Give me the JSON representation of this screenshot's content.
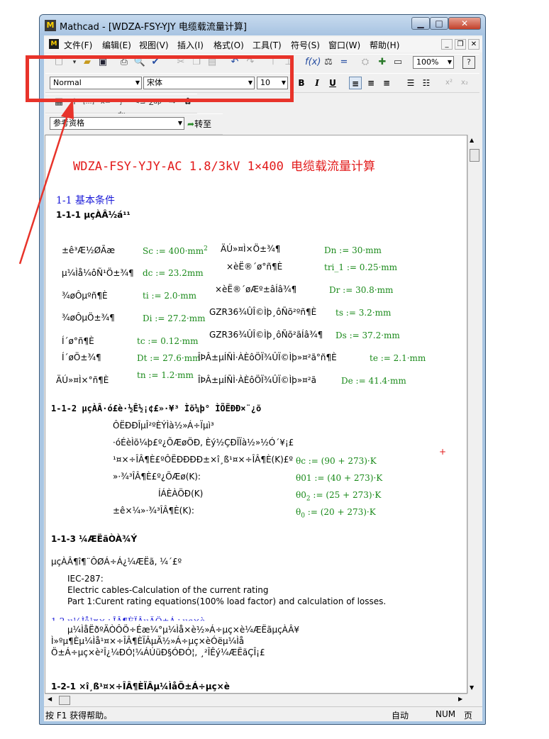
{
  "window": {
    "title": "Mathcad - [WDZA-FSY-YJY 电缆载流量计算]",
    "app_icon": "mathcad-icon",
    "minimize": "▁",
    "maximize": "□",
    "close": "✕"
  },
  "menu": {
    "items": [
      "文件(F)",
      "编辑(E)",
      "视图(V)",
      "插入(I)",
      "格式(O)",
      "工具(T)",
      "符号(S)",
      "窗口(W)",
      "帮助(H)"
    ],
    "mdi_min": "_",
    "mdi_restore": "❐",
    "mdi_close": "✕"
  },
  "toolbar": {
    "zoom": "100%",
    "help": "?"
  },
  "format_bar": {
    "style": "Normal",
    "font": "宋体",
    "size": "10",
    "bold": "B",
    "italic": "I",
    "underline": "U"
  },
  "math_bar": {
    "items": [
      "▦",
      "+",
      "[:::]",
      "x=",
      "∫ dx",
      "<≤",
      "∑ɑβ",
      "⇒",
      "✿"
    ]
  },
  "nav": {
    "reference_value": "参考资格",
    "goto_label": "转至"
  },
  "document": {
    "title": "WDZA-FSY-YJY-AC 1.8/3kV 1×400 电缆载流量计算",
    "h1": "1-1  基本条件",
    "h111": "1-1-1 µçÀÂ½á¹¹",
    "rows": [
      {
        "l1": "±ê³Æ½ØÃæ",
        "e1": "Sc := 400·mm",
        "e1sup": "2",
        "l2": "ÄÚ»¤Ì×Ö±¾¶",
        "e2": "Dn := 30·mm"
      },
      {
        "l1": "µ¼Ìå¼ôÑ¹Ö±¾¶",
        "e1": "dc := 23.2mm",
        "l2": "×èË®´ø°ñ¶È",
        "e2": "tri_1 := 0.25·mm"
      },
      {
        "l1": "¾øÔµºñ¶È",
        "e1": "ti := 2.0·mm",
        "l2": "×èË®´øÆº±âÍâ¾¶",
        "e2": "Dr := 30.8·mm"
      },
      {
        "l1": "¾øÔµÖ±¾¶",
        "e1": "Di := 27.2·mm",
        "l2": "GZR36¾ÛÎ©Ìþ¸ôÑõ²ºñ¶È",
        "e2": "ts := 3.2·mm"
      },
      {
        "l1": "Í­´ø°ñ¶È",
        "e1": "tc := 0.12·mm",
        "l2": "GZR36¾ÛÎ©Ìþ¸ôÑõ²ãÍâ¾¶",
        "e2": "Ds := 37.2·mm"
      },
      {
        "l1": "Í­´øÖ±¾¶",
        "e1": "Dt := 27.6·mm",
        "l2": "ÎÞÂ±µÍÑÌ·ÀÈôÖÏ¾ÛÏ©Ìþ»¤²ã°ñ¶È",
        "e2": "te := 2.1·mm"
      },
      {
        "l1": "ÄÚ»¤Ì×°ñ¶È",
        "e1": "tn := 1.2·mm",
        "l2": "ÎÞÂ±µÍÑÌ·ÀÈôÖÏ¾ÛÏ©Ìþ»¤²ã",
        "e2": "De := 41.4·mm"
      }
    ],
    "h112": "1-1-2 µçÀÂ·ó£è·½Ê½¡¢£»·¥³ Ìõ¼þ° ÌÕËÐÐ×¨¿õ",
    "cond_lines": [
      "ÔËÐÐÎµÎ²ºÈÝÌà½»Á÷Ïµì³",
      "·óÉèÌõ¼þ£º¿ÕÆøÖÐ, Èý½ÇÐÎÏà½»½Ó´¥¡£",
      "¹¤×÷ÎÂ¶È£ºÔËÐÐÐÐ±×î¸ß¹¤×÷ÎÂ¶È(K)£º",
      "»·¾³ÎÂ¶È£º¿ÕÆø(K):",
      "ÍÁÈÀÖÐ(K)",
      "±ê×¼»·¾³ÎÂ¶È(K):"
    ],
    "temps": [
      {
        "name": "θc",
        "sub": "",
        "val": " := (90 + 273)·K"
      },
      {
        "name": "θ01",
        "sub": "",
        "val": " := (40 + 273)·K"
      },
      {
        "name": "θ0",
        "sub": "2",
        "val": " := (25 + 273)·K"
      },
      {
        "name": "θ",
        "sub": "0",
        "val": " := (20 + 273)·K"
      }
    ],
    "h113": "1-1-3 ¼ÆËãÒÀ¾Ý",
    "basis": "µçÀÂ¶î¶¨ÔØÁ÷Á¿¼ÆËã, ¼´£º",
    "refs": [
      "IEC-287:",
      "Electric cables-Calculation of the current rating",
      "Part 1:Curent rating equations(100% load factor) and calculation of losses."
    ],
    "h12_partial": "1-2 µ¼Ìå¹¤×÷ÎÂ¶ÈÏÂµÄÖ±Á÷µç×è",
    "para": [
      "µ¼ÌåËðºÄÒÔÖ÷Éæ¼°µ¼Ìå×è½»Á÷µç×è¼ÆËãµçÀÂ¥",
      "Ì»ºµ¶Èµ¼Ìå¹¤×÷ÎÂ¶ÈÏÂµÄ½»Á÷µç×èÓëµ¼Ìå",
      "Ö±Á÷µç×è²Î¿¼ÐÓ¦¼ÁÚüÐ§ÓÐÓ¦, ¸²ÎÊý¼ÆËãÇÎ¡£"
    ],
    "h121": "1-2-1 ×î¸ß¹¤×÷ÎÂ¶ÈÏÂµ¼ÌåÖ±Á÷µç×è"
  },
  "status": {
    "help": "按 F1 获得帮助。",
    "mode": "自动",
    "num": "NUM",
    "page": "页"
  },
  "colors": {
    "highlight_box": "#e8332a",
    "title_red": "#e21a1a",
    "heading_blue": "#1a1ad8",
    "equation_green": "#1a8a1a"
  }
}
